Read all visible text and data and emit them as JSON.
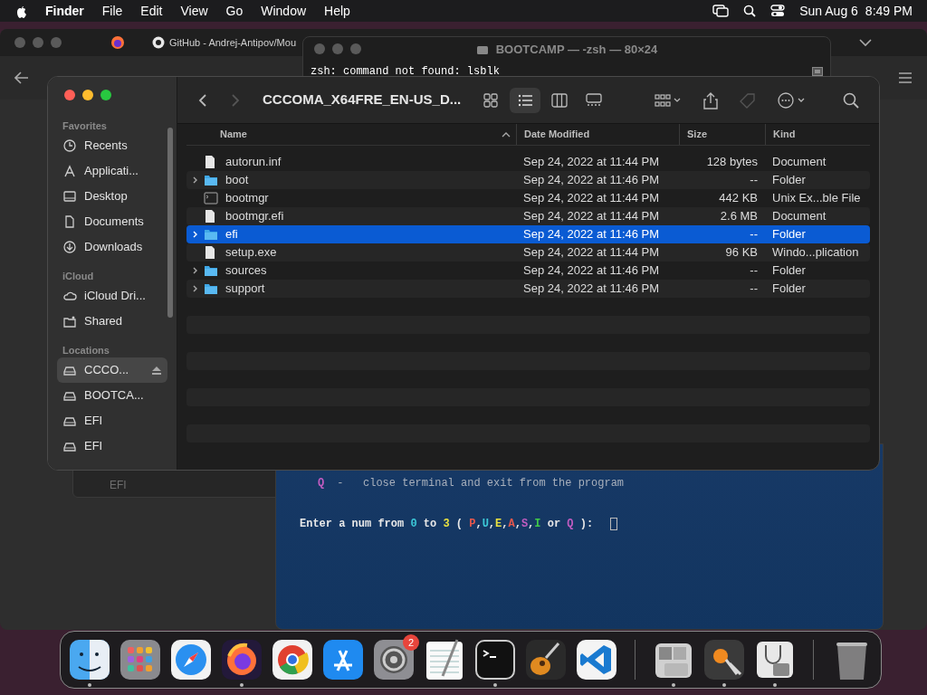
{
  "menu_bar": {
    "app": "Finder",
    "menus": [
      "File",
      "Edit",
      "View",
      "Go",
      "Window",
      "Help"
    ],
    "date": "Sun Aug 6",
    "time": "8:49 PM"
  },
  "browser": {
    "tab_title": "GitHub - Andrej-Antipov/Mou"
  },
  "back_window": {
    "label": "EFI"
  },
  "terminal_top": {
    "title": "BOOTCAMP — -zsh — 80×24",
    "line": "zsh: command not found: lsblk"
  },
  "terminal_bottom": {
    "lines": [
      [
        {
          "text": "Q",
          "color": "#c05cc0"
        },
        {
          "text": "-   close terminal and exit from the program"
        }
      ],
      [
        {
          "text": "Enter a num from "
        },
        {
          "text": "0",
          "color": "#3cc8d8"
        },
        {
          "text": " to "
        },
        {
          "text": "3",
          "color": "#e8e040"
        },
        {
          "text": " ( "
        },
        {
          "text": "P",
          "color": "#e8584c"
        },
        {
          "text": ","
        },
        {
          "text": "U",
          "color": "#3cc8d8"
        },
        {
          "text": ","
        },
        {
          "text": "E",
          "color": "#e8e040"
        },
        {
          "text": ","
        },
        {
          "text": "A",
          "color": "#e8584c"
        },
        {
          "text": ","
        },
        {
          "text": "S",
          "color": "#c05cc0"
        },
        {
          "text": ","
        },
        {
          "text": "I",
          "color": "#40c848"
        },
        {
          "text": " or "
        },
        {
          "text": "Q",
          "color": "#c05cc0"
        },
        {
          "text": " ):  "
        }
      ]
    ]
  },
  "finder": {
    "path_title": "CCCOMA_X64FRE_EN-US_D...",
    "views": [
      {
        "kind": "icons",
        "selected": false
      },
      {
        "kind": "list",
        "selected": true
      },
      {
        "kind": "columns",
        "selected": false
      },
      {
        "kind": "gallery",
        "selected": false
      }
    ],
    "sidebar": [
      {
        "heading": "Favorites",
        "items": [
          {
            "label": "Recents",
            "kind": "clock",
            "selected": false
          },
          {
            "label": "Applicati...",
            "kind": "apps",
            "selected": false
          },
          {
            "label": "Desktop",
            "kind": "desktop",
            "selected": false
          },
          {
            "label": "Documents",
            "kind": "doc",
            "selected": false
          },
          {
            "label": "Downloads",
            "kind": "download",
            "selected": false
          }
        ]
      },
      {
        "heading": "iCloud",
        "items": [
          {
            "label": "iCloud Dri...",
            "kind": "cloud",
            "selected": false
          },
          {
            "label": "Shared",
            "kind": "shared",
            "selected": false
          }
        ]
      },
      {
        "heading": "Locations",
        "items": [
          {
            "label": "CCCO...",
            "kind": "drive",
            "selected": true,
            "eject": true
          },
          {
            "label": "BOOTCA...",
            "kind": "drive",
            "selected": false,
            "eject": false
          },
          {
            "label": "EFI",
            "kind": "drive",
            "selected": false,
            "eject": false
          },
          {
            "label": "EFI",
            "kind": "drive",
            "selected": false,
            "eject": false
          }
        ]
      }
    ],
    "columns": [
      "Name",
      "Date Modified",
      "Size",
      "Kind"
    ],
    "rows": [
      {
        "name": "autorun.inf",
        "kind": "file",
        "expandable": false,
        "date": "Sep 24, 2022 at 11:44 PM",
        "size": "128 bytes",
        "file_kind": "Document",
        "selected": false
      },
      {
        "name": "boot",
        "kind": "folder",
        "expandable": true,
        "date": "Sep 24, 2022 at 11:46 PM",
        "size": "--",
        "file_kind": "Folder",
        "selected": false
      },
      {
        "name": "bootmgr",
        "kind": "exec",
        "expandable": false,
        "date": "Sep 24, 2022 at 11:44 PM",
        "size": "442 KB",
        "file_kind": "Unix Ex...ble File",
        "selected": false
      },
      {
        "name": "bootmgr.efi",
        "kind": "file",
        "expandable": false,
        "date": "Sep 24, 2022 at 11:44 PM",
        "size": "2.6 MB",
        "file_kind": "Document",
        "selected": false
      },
      {
        "name": "efi",
        "kind": "folder",
        "expandable": true,
        "date": "Sep 24, 2022 at 11:46 PM",
        "size": "--",
        "file_kind": "Folder",
        "selected": true
      },
      {
        "name": "setup.exe",
        "kind": "file",
        "expandable": false,
        "date": "Sep 24, 2022 at 11:44 PM",
        "size": "96 KB",
        "file_kind": "Windo...plication",
        "selected": false
      },
      {
        "name": "sources",
        "kind": "folder",
        "expandable": true,
        "date": "Sep 24, 2022 at 11:46 PM",
        "size": "--",
        "file_kind": "Folder",
        "selected": false
      },
      {
        "name": "support",
        "kind": "folder",
        "expandable": true,
        "date": "Sep 24, 2022 at 11:46 PM",
        "size": "--",
        "file_kind": "Folder",
        "selected": false
      }
    ]
  },
  "dock": [
    {
      "kind": "finder",
      "running": true
    },
    {
      "kind": "launchpad",
      "running": false
    },
    {
      "kind": "safari",
      "running": false
    },
    {
      "kind": "firefox",
      "running": true
    },
    {
      "kind": "chrome",
      "running": false
    },
    {
      "kind": "appstore",
      "running": false
    },
    {
      "kind": "settings",
      "running": false,
      "badge": "2"
    },
    {
      "kind": "textedit",
      "running": false
    },
    {
      "kind": "terminal",
      "running": true
    },
    {
      "kind": "guitar",
      "running": false
    },
    {
      "kind": "vscode",
      "running": false
    },
    {
      "kind": "separator"
    },
    {
      "kind": "bootcamp",
      "running": true
    },
    {
      "kind": "keychain",
      "running": true
    },
    {
      "kind": "diskutility",
      "running": true
    },
    {
      "kind": "separator"
    },
    {
      "kind": "trash",
      "running": false
    }
  ]
}
